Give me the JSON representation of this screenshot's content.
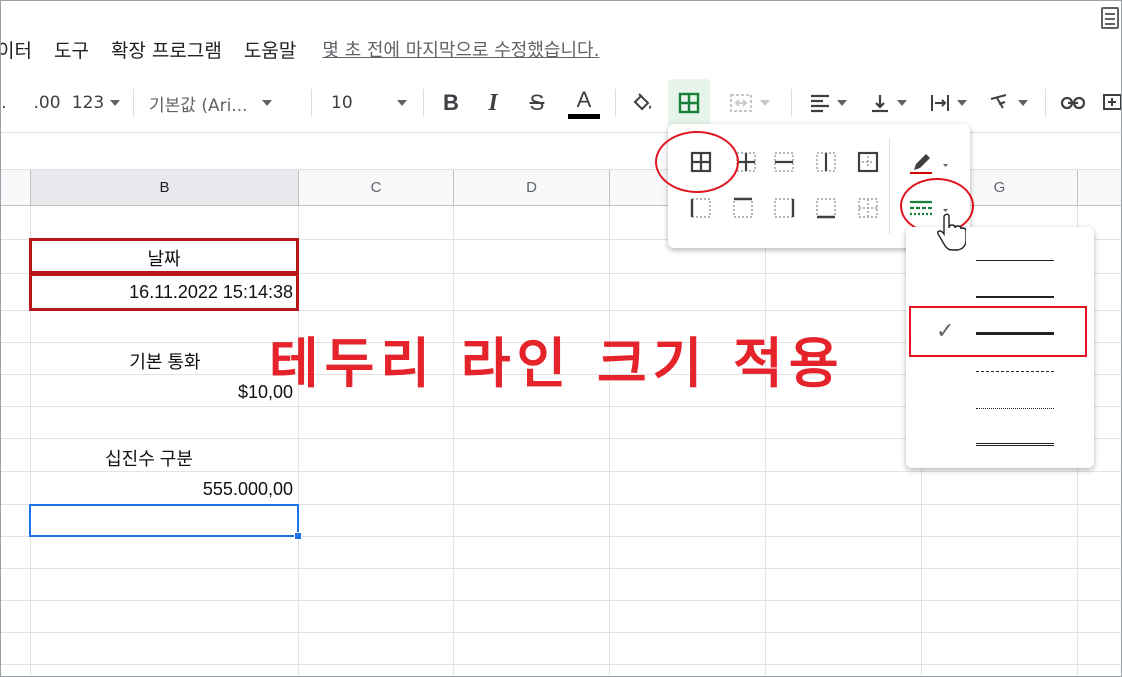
{
  "menu": {
    "items": [
      "이터",
      "도구",
      "확장 프로그램",
      "도움말"
    ],
    "last_edit": "몇 초 전에 마지막으로 수정했습니다."
  },
  "toolbar": {
    "decimal_more": ".00",
    "number_format": "123",
    "font": "기본값 (Ari...",
    "font_size": "10",
    "bold": "B",
    "italic": "I",
    "strike": "S",
    "text_color": "A"
  },
  "columns": [
    "B",
    "C",
    "D",
    "G"
  ],
  "cells": {
    "date_label": "날짜",
    "date_value": "16.11.2022 15:14:38",
    "currency_label": "기본 통화",
    "currency_value": "$10,00",
    "decimal_label": "십진수 구분",
    "decimal_value": "555.000,00"
  },
  "caption": "테두리 라인 크기 적용",
  "colors": {
    "accent_red": "#e5232b",
    "box_red": "#b7161b",
    "selection_blue": "#1a73e8",
    "border_green": "#188038"
  },
  "border_menu": {
    "icons": [
      "all-borders",
      "inner-borders",
      "horizontal-borders",
      "vertical-borders",
      "outer-borders",
      "left-border",
      "top-border",
      "right-border",
      "bottom-border",
      "clear-borders"
    ],
    "selected": "all-borders"
  },
  "line_styles": {
    "options": [
      "thin-solid",
      "medium-solid",
      "thick-solid",
      "dashed",
      "dotted",
      "double"
    ],
    "selected": "thick-solid"
  }
}
